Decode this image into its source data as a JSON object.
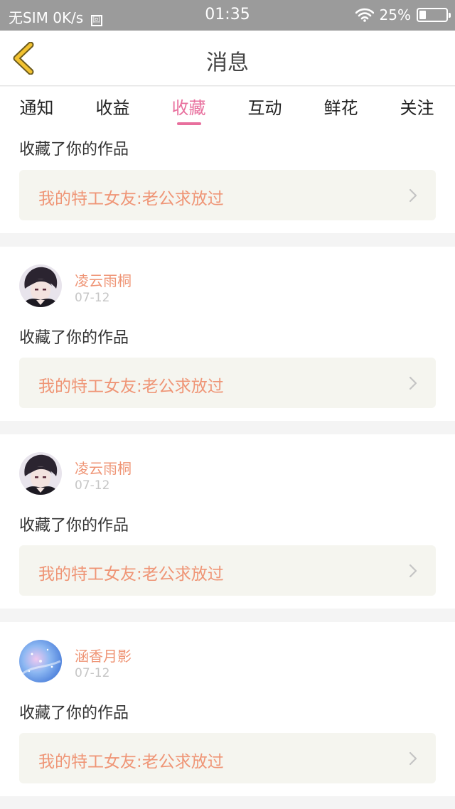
{
  "status_bar": {
    "carrier": "无SIM",
    "speed": "0K/s",
    "sim_glyph": "回",
    "time": "01:35",
    "battery": "25%",
    "battery_level": 0.25
  },
  "header": {
    "title": "消息"
  },
  "tabs": [
    {
      "label": "通知"
    },
    {
      "label": "收益"
    },
    {
      "label": "收藏",
      "active": true
    },
    {
      "label": "互动"
    },
    {
      "label": "鲜花"
    },
    {
      "label": "关注"
    }
  ],
  "notifications": [
    {
      "action": "收藏了你的作品",
      "work_title": "我的特工女友:老公求放过"
    },
    {
      "username": "凌云雨桐",
      "date": "07-12",
      "action": "收藏了你的作品",
      "work_title": "我的特工女友:老公求放过",
      "avatar": "anime-boy"
    },
    {
      "username": "凌云雨桐",
      "date": "07-12",
      "action": "收藏了你的作品",
      "work_title": "我的特工女友:老公求放过",
      "avatar": "anime-boy"
    },
    {
      "username": "涵香月影",
      "date": "07-12",
      "action": "收藏了你的作品",
      "work_title": "我的特工女友:老公求放过",
      "avatar": "blue-galaxy"
    }
  ],
  "colors": {
    "accent": "#e86f9d",
    "link": "#ef9576",
    "status_bar": "#9b9b9b",
    "back_arrow": "#f2c230"
  }
}
